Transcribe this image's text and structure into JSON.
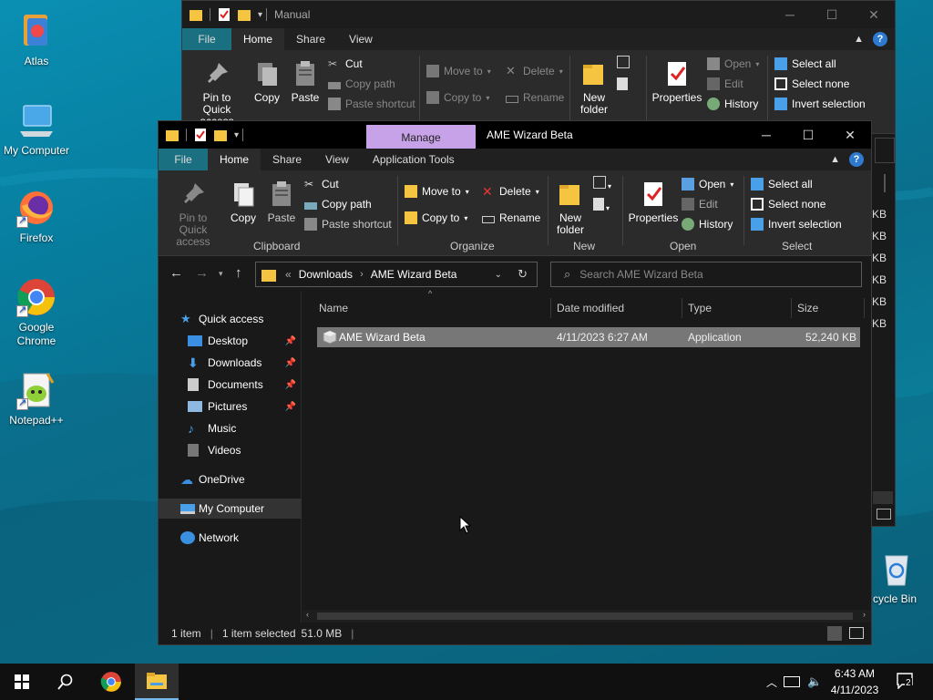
{
  "desktop": {
    "icons": [
      {
        "label": "Atlas",
        "icon": "atlas-icon"
      },
      {
        "label": "My Computer",
        "icon": "computer-icon"
      },
      {
        "label": "Firefox",
        "icon": "firefox-icon"
      },
      {
        "label": "Google Chrome",
        "icon": "chrome-icon"
      },
      {
        "label": "Notepad++",
        "icon": "notepadpp-icon"
      },
      {
        "label": "cycle Bin",
        "icon": "recycle-bin-icon"
      }
    ]
  },
  "back_window": {
    "title": "Manual",
    "tabs": {
      "file": "File",
      "home": "Home",
      "share": "Share",
      "view": "View"
    },
    "ribbon": {
      "pin": "Pin to Quick access",
      "copy": "Copy",
      "paste": "Paste",
      "cut": "Cut",
      "copy_path": "Copy path",
      "paste_shortcut": "Paste shortcut",
      "move_to": "Move to",
      "copy_to": "Copy to",
      "delete": "Delete",
      "rename": "Rename",
      "new_folder": "New folder",
      "properties": "Properties",
      "open": "Open",
      "edit": "Edit",
      "history": "History",
      "select_all": "Select all",
      "select_none": "Select none",
      "invert_selection": "Invert selection"
    },
    "peek_sizes": [
      "KB",
      "KB",
      "KB",
      "KB",
      "KB",
      "KB"
    ]
  },
  "window": {
    "title": "AME Wizard Beta",
    "context_tab": "Manage",
    "tabs": {
      "file": "File",
      "home": "Home",
      "share": "Share",
      "view": "View",
      "app_tools": "Application Tools"
    },
    "ribbon": {
      "pin": "Pin to Quick access",
      "copy": "Copy",
      "paste": "Paste",
      "cut": "Cut",
      "copy_path": "Copy path",
      "paste_shortcut": "Paste shortcut",
      "move_to": "Move to",
      "copy_to": "Copy to",
      "delete": "Delete",
      "rename": "Rename",
      "new_folder": "New folder",
      "properties": "Properties",
      "open": "Open",
      "edit": "Edit",
      "history": "History",
      "select_all": "Select all",
      "select_none": "Select none",
      "invert_selection": "Invert selection",
      "groups": {
        "clipboard": "Clipboard",
        "organize": "Organize",
        "new": "New",
        "open": "Open",
        "select": "Select"
      }
    },
    "address": {
      "prefix": "«",
      "crumbs": [
        "Downloads",
        "AME Wizard Beta"
      ],
      "search_placeholder": "Search AME Wizard Beta"
    },
    "nav": {
      "quick_access": "Quick access",
      "items": [
        {
          "label": "Desktop",
          "pinned": true
        },
        {
          "label": "Downloads",
          "pinned": true
        },
        {
          "label": "Documents",
          "pinned": true
        },
        {
          "label": "Pictures",
          "pinned": true
        },
        {
          "label": "Music",
          "pinned": false
        },
        {
          "label": "Videos",
          "pinned": false
        }
      ],
      "onedrive": "OneDrive",
      "my_computer": "My Computer",
      "network": "Network"
    },
    "columns": {
      "name": "Name",
      "date": "Date modified",
      "type": "Type",
      "size": "Size"
    },
    "files": [
      {
        "name": "AME Wizard Beta",
        "date": "4/11/2023 6:27 AM",
        "type": "Application",
        "size": "52,240 KB"
      }
    ],
    "status": {
      "count": "1 item",
      "selected": "1 item selected",
      "size": "51.0 MB"
    }
  },
  "taskbar": {
    "time": "6:43 AM",
    "date": "4/11/2023",
    "notifications": "2"
  },
  "colors": {
    "accent": "#1a6f80",
    "manage_tab": "#c8a2e8",
    "selection": "#777777",
    "taskbar": "#101010"
  }
}
